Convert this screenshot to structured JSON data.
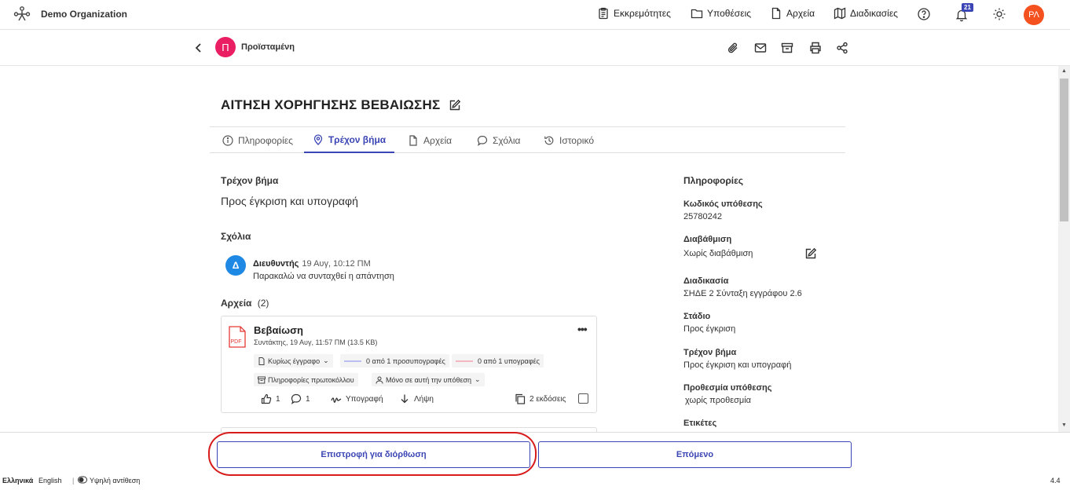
{
  "header": {
    "org_name": "Demo Organization",
    "nav": [
      {
        "label": "Εκκρεμότητες",
        "icon": "clipboard-icon"
      },
      {
        "label": "Υποθέσεις",
        "icon": "folder-icon"
      },
      {
        "label": "Αρχεία",
        "icon": "file-icon"
      },
      {
        "label": "Διαδικασίες",
        "icon": "map-icon"
      }
    ],
    "notifications_count": "21",
    "user_initials": "ΡΛ"
  },
  "subheader": {
    "avatar_letter": "Π",
    "role_name": "Προϊσταμένη"
  },
  "case": {
    "title": "ΑΙΤΗΣΗ ΧΟΡΗΓΗΣΗΣ ΒΕΒΑΙΩΣΗΣ",
    "tabs": [
      {
        "label": "Πληροφορίες"
      },
      {
        "label": "Τρέχον βήμα",
        "active": true
      },
      {
        "label": "Αρχεία"
      },
      {
        "label": "Σχόλια"
      },
      {
        "label": "Ιστορικό"
      }
    ]
  },
  "current_step": {
    "heading": "Τρέχον βήμα",
    "value": "Προς έγκριση και υπογραφή"
  },
  "comments": {
    "heading": "Σχόλια",
    "items": [
      {
        "avatar": "Δ",
        "author": "Διευθυντής",
        "time": "19 Αυγ, 10:12 ΠΜ",
        "text": "Παρακαλώ να συνταχθεί η απάντηση"
      }
    ]
  },
  "files": {
    "heading": "Αρχεία",
    "count": "(2)",
    "items": [
      {
        "name": "Βεβαίωση",
        "meta": "Συντάκτης, 19 Αυγ, 11:57 ΠΜ (13.5 KB)",
        "doc_type": "Κυρίως έγγραφο",
        "co_signatures": "0 από 1 προσυπογραφές",
        "signatures": "0 από 1 υπογραφές",
        "protocol_info": "Πληροφορίες πρωτοκόλλου",
        "visibility": "Μόνο σε αυτή την υπόθεση",
        "likes": "1",
        "comments": "1",
        "sign_label": "Υπογραφή",
        "download_label": "Λήψη",
        "versions": "2 εκδόσεις"
      }
    ]
  },
  "info": {
    "heading": "Πληροφορίες",
    "fields": [
      {
        "label": "Κωδικός υπόθεσης",
        "value": "25780242"
      },
      {
        "label": "Διαβάθμιση",
        "value": "Χωρίς διαβάθμιση"
      },
      {
        "label": "Διαδικασία",
        "value": "ΣΗΔΕ 2 Σύνταξη εγγράφου 2.6"
      },
      {
        "label": "Στάδιο",
        "value": "Προς έγκριση"
      },
      {
        "label": "Τρέχον βήμα",
        "value": "Προς έγκριση και υπογραφή"
      },
      {
        "label": "Προθεσμία υπόθεσης",
        "value": "χωρίς προθεσμία"
      },
      {
        "label": "Ετικέτες",
        "value": ""
      }
    ]
  },
  "actions": {
    "return_label": "Επιστροφή για διόρθωση",
    "next_label": "Επόμενο"
  },
  "footer": {
    "lang_el": "Ελληνικά",
    "lang_en": "English",
    "contrast": "Υψηλή αντίθεση",
    "version": "4.4"
  },
  "colors": {
    "accent": "#3b45b5",
    "highlight_ring": "#d81b1b",
    "user_avatar": "#f4511e",
    "role_avatar": "#e91e63",
    "comment_avatar": "#1e88e5",
    "co_signature_line": "#b9bdf0",
    "signature_line": "#f4b6c2"
  }
}
